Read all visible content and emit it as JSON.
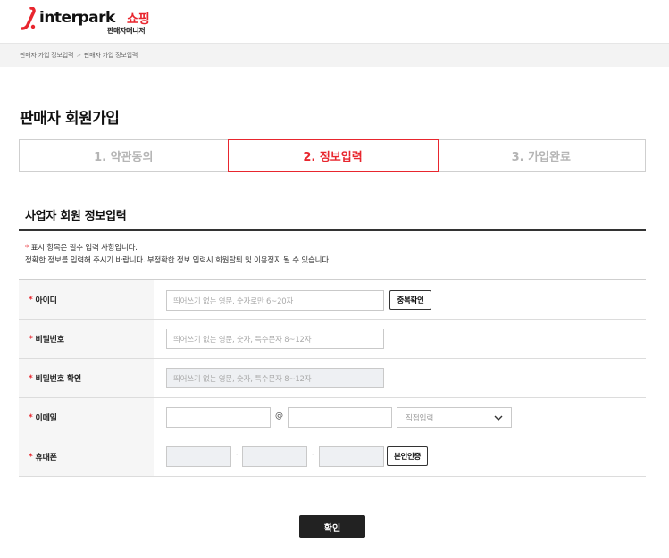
{
  "header": {
    "logo_text": "interpark",
    "logo_shop": "쇼핑",
    "logo_sub": "판매자매니저"
  },
  "breadcrumb": [
    "판매자 가입 정보입력",
    "판매자 가입 정보입력"
  ],
  "page_title": "판매자 회원가입",
  "steps": [
    {
      "label": "1. 약관동의",
      "active": false
    },
    {
      "label": "2. 정보입력",
      "active": true
    },
    {
      "label": "3. 가입완료",
      "active": false
    }
  ],
  "section_title": "사업자 회원 정보입력",
  "notice": {
    "star": "*",
    "line1": "표시 항목은 필수 입력 사항입니다.",
    "line2": "정확한 정보를 입력해 주시기 바랍니다. 부정확한 정보 입력시 회원탈퇴 및 이용정지 될 수 있습니다."
  },
  "form": {
    "star": "*",
    "id": {
      "label": "아이디",
      "placeholder": "띄어쓰기 없는 영문, 숫자로만 6~20자",
      "button": "중복확인"
    },
    "password": {
      "label": "비밀번호",
      "placeholder": "띄어쓰기 없는 영문, 숫자, 특수문자 8~12자"
    },
    "password_confirm": {
      "label": "비밀번호 확인",
      "placeholder": "띄어쓰기 없는 영문, 숫자, 특수문자 8~12자"
    },
    "email": {
      "label": "이메일",
      "at": "@",
      "select_value": "직접입력"
    },
    "phone": {
      "label": "휴대폰",
      "dash": "-",
      "button": "본인인증"
    }
  },
  "confirm_button": "확인",
  "colors": {
    "accent": "#e8262e",
    "dark_button": "#222222"
  }
}
